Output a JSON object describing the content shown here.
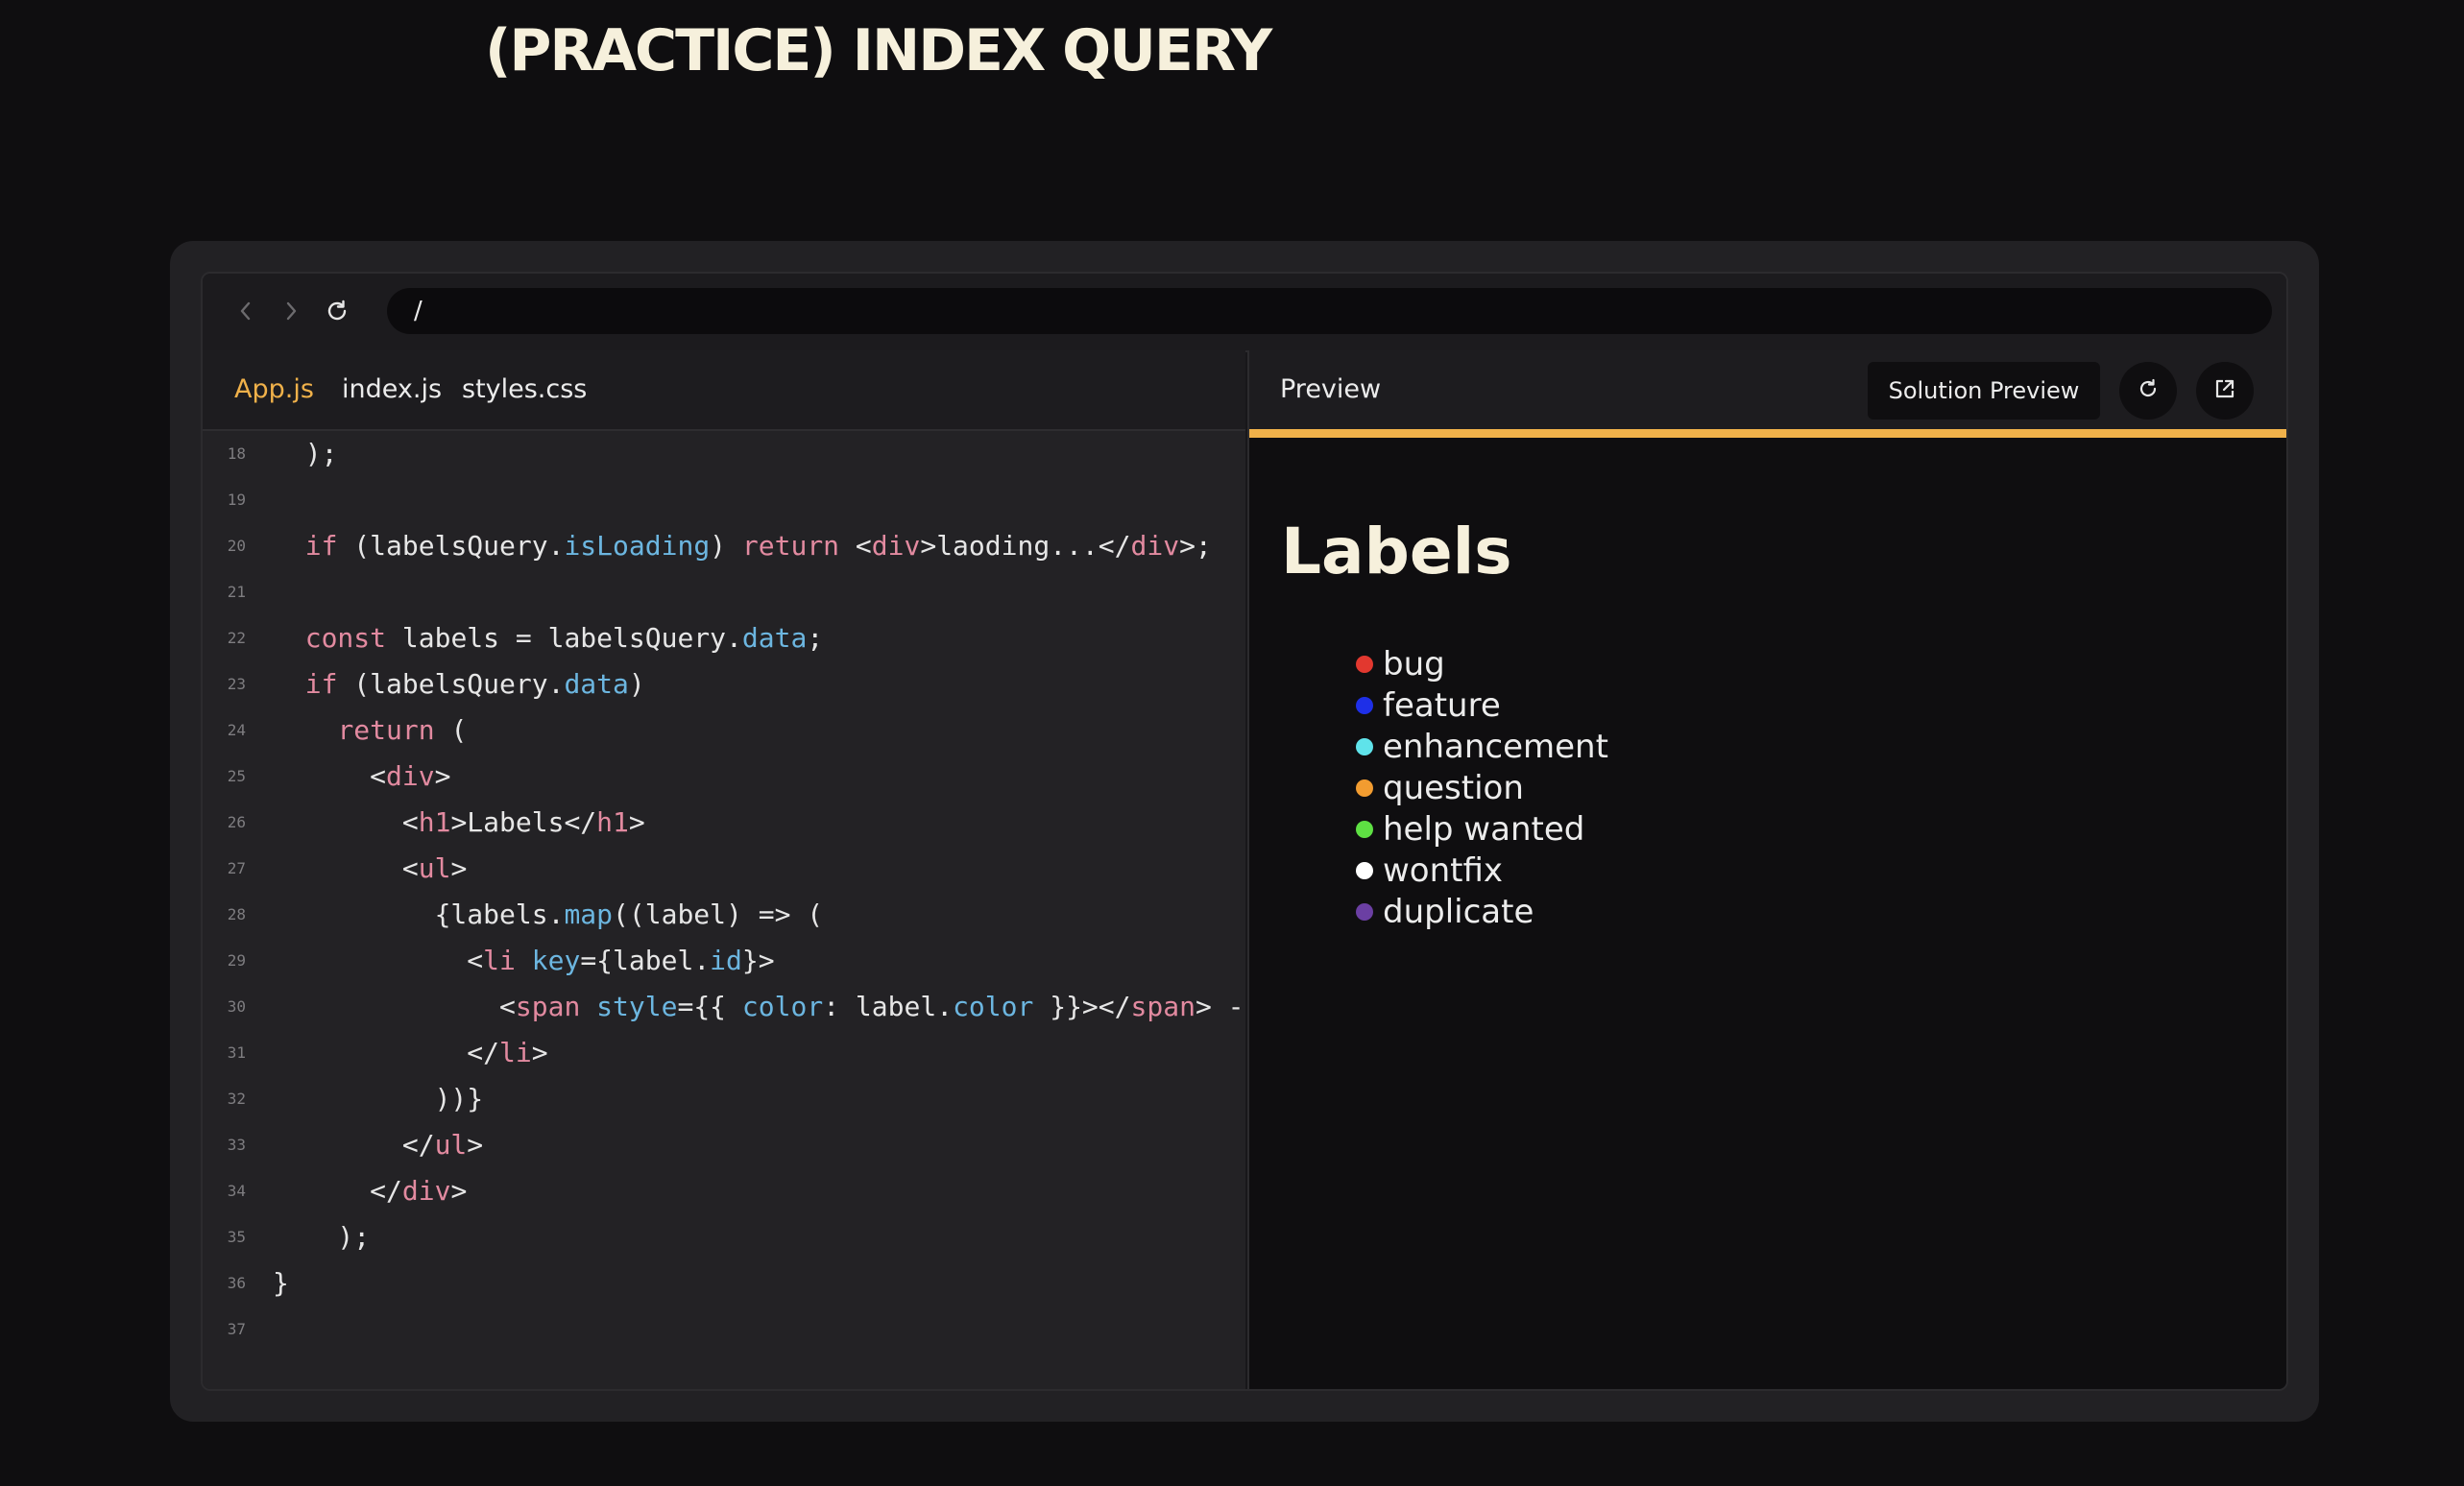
{
  "page": {
    "title": "(PRACTICE) INDEX QUERY"
  },
  "browser": {
    "url": "/"
  },
  "editor": {
    "tabs": [
      {
        "label": "App.js",
        "active": true
      },
      {
        "label": "index.js",
        "active": false
      },
      {
        "label": "styles.css",
        "active": false
      }
    ],
    "lines": [
      {
        "n": "18",
        "code": "  );"
      },
      {
        "n": "19",
        "code": ""
      },
      {
        "n": "20",
        "code": "  if (labelsQuery.isLoading) return <div>laoding...</div>;"
      },
      {
        "n": "21",
        "code": ""
      },
      {
        "n": "22",
        "code": "  const labels = labelsQuery.data;"
      },
      {
        "n": "23",
        "code": "  if (labelsQuery.data)"
      },
      {
        "n": "24",
        "code": "    return ("
      },
      {
        "n": "25",
        "code": "      <div>"
      },
      {
        "n": "26",
        "code": "        <h1>Labels</h1>"
      },
      {
        "n": "27",
        "code": "        <ul>"
      },
      {
        "n": "28",
        "code": "          {labels.map((label) => ("
      },
      {
        "n": "29",
        "code": "            <li key={label.id}>"
      },
      {
        "n": "30",
        "code": "              <span style={{ color: label.color }}></span> -"
      },
      {
        "n": "31",
        "code": "            </li>"
      },
      {
        "n": "32",
        "code": "          ))}"
      },
      {
        "n": "33",
        "code": "        </ul>"
      },
      {
        "n": "34",
        "code": "      </div>"
      },
      {
        "n": "35",
        "code": "    );"
      },
      {
        "n": "36",
        "code": "}"
      },
      {
        "n": "37",
        "code": ""
      }
    ]
  },
  "preview": {
    "label": "Preview",
    "solution_button": "Solution Preview",
    "accent_color": "#f0b14a",
    "heading": "Labels",
    "labels": [
      {
        "name": "bug",
        "color": "#e2382f"
      },
      {
        "name": "feature",
        "color": "#1e2fe8"
      },
      {
        "name": "enhancement",
        "color": "#5fe3ea"
      },
      {
        "name": "question",
        "color": "#f29c30"
      },
      {
        "name": "help wanted",
        "color": "#5ee043"
      },
      {
        "name": "wontfix",
        "color": "#ffffff"
      },
      {
        "name": "duplicate",
        "color": "#6b3fa3"
      }
    ]
  }
}
